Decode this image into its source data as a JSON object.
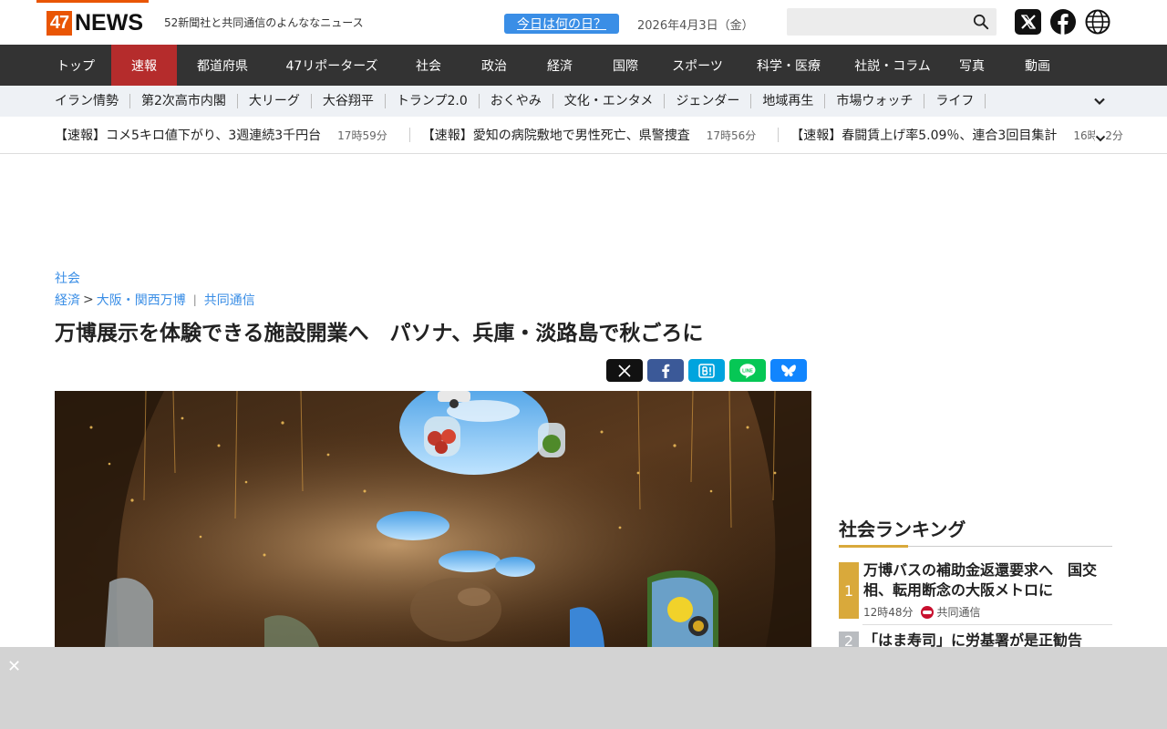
{
  "header": {
    "logo_num": "47",
    "logo_text": "NEWS",
    "tagline": "52新聞社と共同通信のよんななニュース",
    "today_button": "今日は何の日？",
    "date": "2026年4月3日（金）",
    "search_placeholder": ""
  },
  "main_nav": [
    {
      "label": "トップ",
      "active": false
    },
    {
      "label": "速報",
      "active": true
    },
    {
      "label": "都道府県",
      "active": false
    },
    {
      "label": "47リポーターズ",
      "active": false
    },
    {
      "label": "社会",
      "active": false
    },
    {
      "label": "政治",
      "active": false
    },
    {
      "label": "経済",
      "active": false
    },
    {
      "label": "国際",
      "active": false
    },
    {
      "label": "スポーツ",
      "active": false
    },
    {
      "label": "科学・医療",
      "active": false
    },
    {
      "label": "社説・コラム",
      "active": false
    },
    {
      "label": "写真",
      "active": false
    },
    {
      "label": "動画",
      "active": false
    }
  ],
  "sub_nav": [
    "イラン情勢",
    "第2次高市内閣",
    "大リーグ",
    "大谷翔平",
    "トランプ2.0",
    "おくやみ",
    "文化・エンタメ",
    "ジェンダー",
    "地域再生",
    "市場ウォッチ",
    "ライフ"
  ],
  "ticker": [
    {
      "text": "【速報】コメ5キロ値下がり、3週連続3千円台",
      "time": "17時59分"
    },
    {
      "text": "【速報】愛知の病院敷地で男性死亡、県警捜査",
      "time": "17時56分"
    },
    {
      "text": "【速報】春闘賃上げ率5.09％、連合3回目集計",
      "time": "16時32分"
    }
  ],
  "article": {
    "category": "社会",
    "breadcrumb_parent": "経済",
    "breadcrumb_child": "大阪・関西万博",
    "source": "共同通信",
    "title": "万博展示を体験できる施設開業へ　パソナ、兵庫・淡路島で秋ごろに"
  },
  "ranking": {
    "title": "社会ランキング",
    "items": [
      {
        "rank": "1",
        "text": "万博バスの補助金返還要求へ　国交相、転用断念の大阪メトロに",
        "time": "12時48分",
        "source": "共同通信"
      },
      {
        "rank": "2",
        "text": "「はま寿司」に労基署が是正勧告"
      }
    ]
  },
  "ad": {
    "close_label": "✕"
  },
  "colors": {
    "accent_orange": "#e95504",
    "nav_dark": "#333333",
    "nav_active": "#b52c2c",
    "link_blue": "#3a8ee6",
    "rank_gold": "#d9a93b"
  }
}
